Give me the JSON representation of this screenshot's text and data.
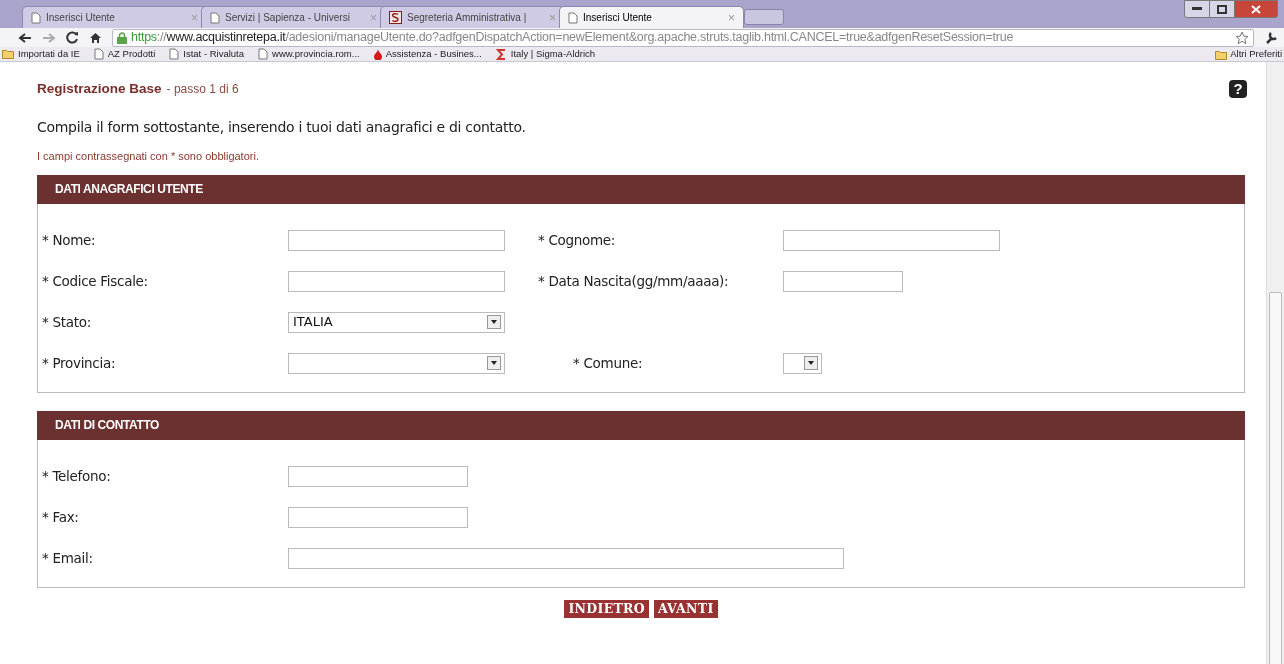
{
  "tabs": [
    {
      "label": "Inserisci Utente",
      "selected": false,
      "close": "×"
    },
    {
      "label": "Servizi | Sapienza - Universi",
      "selected": false,
      "close": "×"
    },
    {
      "label": "Segreteria Amministrativa |",
      "selected": false,
      "close": "×"
    },
    {
      "label": "Inserisci Utente",
      "selected": true,
      "close": "×"
    }
  ],
  "address_bar": {
    "scheme": "https",
    "separator": "://",
    "host": "www.acquistinretepa.it",
    "path": "/adesioni/manageUtente.do?adfgenDispatchAction=newElement&org.apache.struts.taglib.html.CANCEL=true&adfgenResetSession=true"
  },
  "bookmarks": [
    {
      "label": "Importati da IE"
    },
    {
      "label": "AZ Prodotti"
    },
    {
      "label": "Istat - Rivaluta"
    },
    {
      "label": "www.provincia.rom..."
    },
    {
      "label": "Assistenza - Busines..."
    },
    {
      "label": "Italy | Sigma-Aldrich"
    }
  ],
  "other_bookmarks": "Altri Preferiti",
  "page": {
    "title": "Registrazione Base",
    "step": "- passo 1 di 6",
    "help": "?",
    "intro": "Compila il form sottostante, inserendo i tuoi dati anagrafici e di contatto.",
    "required_note": "I campi contrassegnati con * sono obbligatori.",
    "sections": [
      {
        "title": "DATI ANAGRAFICI UTENTE",
        "rows": [
          [
            {
              "label": "* Nome:",
              "kind": "text"
            },
            {
              "label": "* Cognome:",
              "kind": "text"
            }
          ],
          [
            {
              "label": "* Codice Fiscale:",
              "kind": "text"
            },
            {
              "label": "* Data Nascita(gg/mm/aaaa):",
              "kind": "text"
            }
          ],
          [
            {
              "label": "* Stato:",
              "kind": "select",
              "value": "ITALIA"
            }
          ],
          [
            {
              "label": "* Provincia:",
              "kind": "select"
            },
            {
              "label": "* Comune:",
              "kind": "select"
            }
          ]
        ]
      },
      {
        "title": "DATI DI CONTATTO",
        "rows": [
          [
            {
              "label": "* Telefono:",
              "kind": "text"
            }
          ],
          [
            {
              "label": "* Fax:",
              "kind": "text"
            }
          ],
          [
            {
              "label": "* Email:",
              "kind": "text"
            }
          ]
        ]
      }
    ],
    "buttons": [
      "INDIETRO",
      "AVANTI"
    ]
  }
}
